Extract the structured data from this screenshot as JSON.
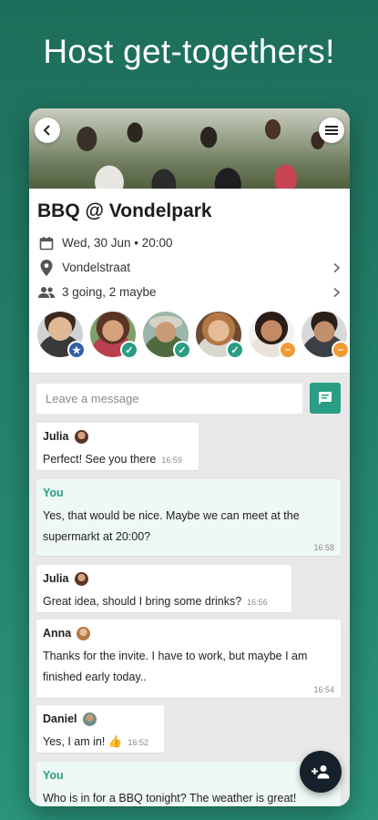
{
  "headline": "Host get-togethers!",
  "icons": {
    "back": "back-arrow-icon",
    "menu": "menu-icon",
    "calendar": "calendar-icon",
    "location": "location-pin-icon",
    "people": "people-icon",
    "chevron": "chevron-right-icon",
    "send": "message-icon",
    "invite": "add-person-icon"
  },
  "event": {
    "title": "BBQ @ Vondelpark",
    "date": "Wed, 30 Jun • 20:00",
    "location": "Vondelstraat",
    "attendance": "3 going, 2 maybe"
  },
  "attendees": [
    {
      "status": "host",
      "badge_color": "#2f5fa8"
    },
    {
      "status": "going",
      "badge_color": "#2a9d83"
    },
    {
      "status": "going",
      "badge_color": "#2a9d83"
    },
    {
      "status": "going",
      "badge_color": "#2a9d83"
    },
    {
      "status": "maybe",
      "badge_color": "#f29b35"
    },
    {
      "status": "maybe",
      "badge_color": "#f29b35"
    }
  ],
  "composer": {
    "placeholder": "Leave a message"
  },
  "messages": [
    {
      "sender": "Julia",
      "text": "Perfect! See you there",
      "time": "16:59"
    },
    {
      "sender": "You",
      "text": "Yes, that would be nice. Maybe we can meet at the supermarkt at 20:00?",
      "time": "16:58"
    },
    {
      "sender": "Julia",
      "text": "Great idea, should I bring some drinks?",
      "time": "16:56"
    },
    {
      "sender": "Anna",
      "text": "Thanks for the invite. I have to work, but maybe I am finished early today..",
      "time": "16:54"
    },
    {
      "sender": "Daniel",
      "text": "Yes, I am in! 👍",
      "time": "16:52"
    },
    {
      "sender": "You",
      "text": "Who is in for a BBQ tonight? The weather is great!",
      "time": ""
    }
  ],
  "colors": {
    "accent": "#2a9d83",
    "host_badge": "#2f5fa8",
    "maybe_badge": "#f29b35",
    "fab": "#15202a"
  }
}
